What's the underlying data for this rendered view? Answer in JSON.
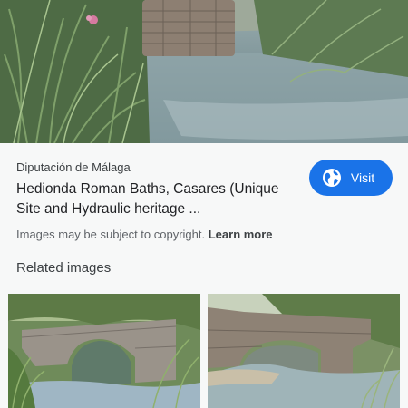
{
  "result": {
    "source": "Diputación de Málaga",
    "title": "Hedionda Roman Baths, Casares (Unique Site and Hydraulic heritage ...",
    "visit_label": "Visit",
    "visit_icon": "globe-icon"
  },
  "copyright": {
    "text": "Images may be subject to copyright.",
    "learn_more": "Learn more"
  },
  "related": {
    "heading": "Related images"
  },
  "colors": {
    "accent": "#1a73e8",
    "background": "#f7f8f8"
  }
}
